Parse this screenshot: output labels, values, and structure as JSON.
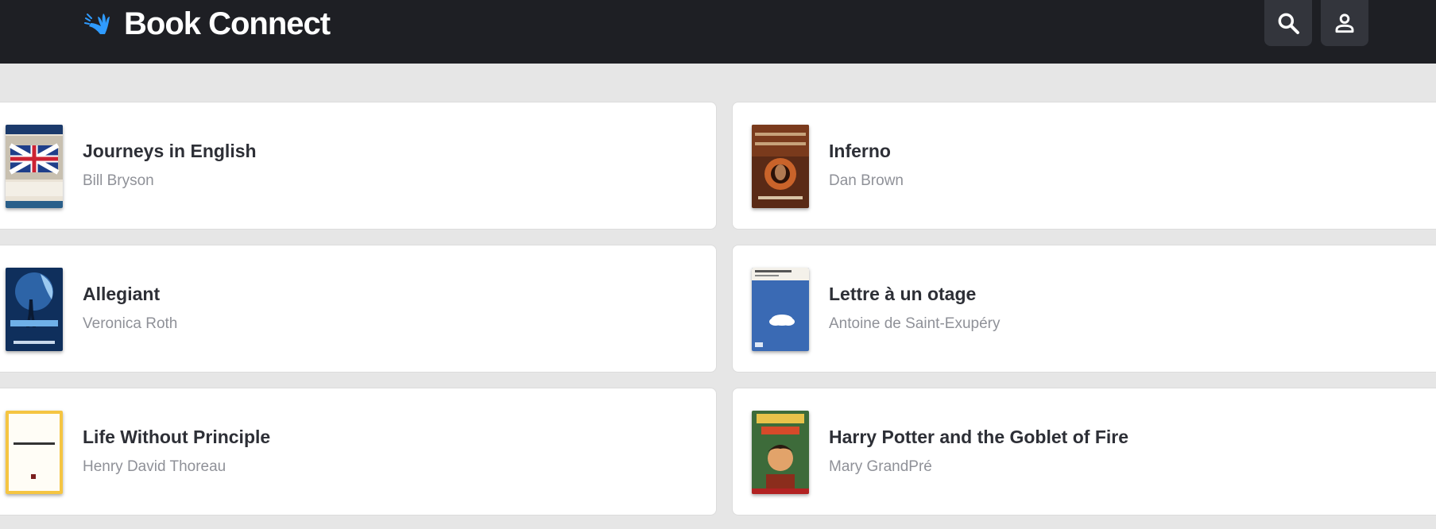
{
  "header": {
    "brand_title": "Book Connect",
    "logo_icon": "hand-wave-logo",
    "search_icon": "search-icon",
    "account_icon": "person-icon"
  },
  "colors": {
    "header_bg": "#1e1f24",
    "page_bg": "#e6e6e6",
    "logo_accent": "#2f9bff",
    "title_text": "#2d2f36",
    "author_text": "#8f9198"
  },
  "books": [
    {
      "title": "Journeys in English",
      "author": "Bill Bryson"
    },
    {
      "title": "Inferno",
      "author": "Dan Brown"
    },
    {
      "title": "Allegiant",
      "author": "Veronica Roth"
    },
    {
      "title": "Lettre à un otage",
      "author": "Antoine de Saint-Exupéry"
    },
    {
      "title": "Life Without Principle",
      "author": "Henry David Thoreau"
    },
    {
      "title": "Harry Potter and the Goblet of Fire",
      "author": "Mary GrandPré"
    }
  ]
}
